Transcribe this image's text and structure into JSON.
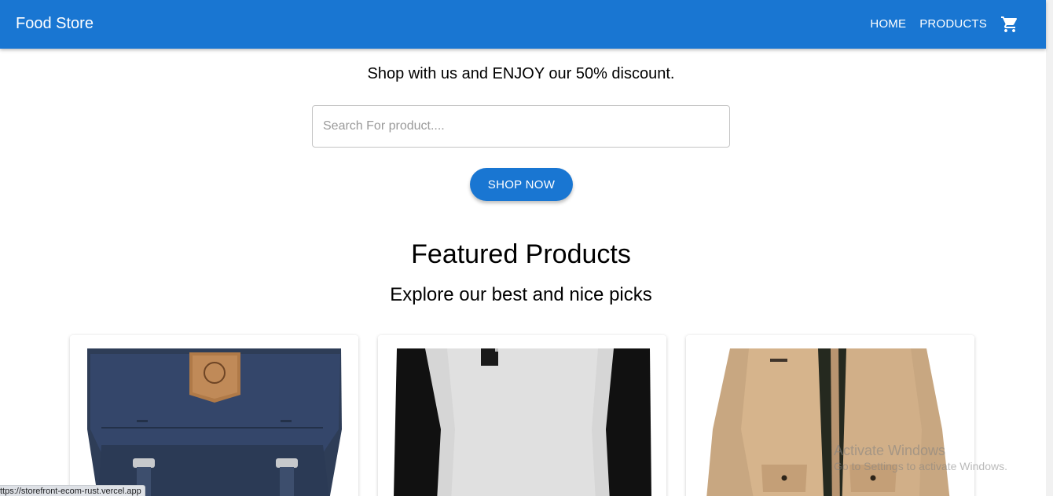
{
  "header": {
    "brand": "Food Store",
    "nav": [
      {
        "label": "HOME"
      },
      {
        "label": "PRODUCTS"
      }
    ],
    "cart_icon": "shopping-cart-icon",
    "color": "#1976d2"
  },
  "hero": {
    "promo": "Shop with us and ENJOY our 50% discount.",
    "search_placeholder": "Search For product....",
    "shop_button": "SHOP NOW"
  },
  "featured": {
    "title": "Featured Products",
    "subtitle": "Explore our best and nice picks",
    "products": [
      {
        "image": "navy-backpack-image"
      },
      {
        "image": "raglan-tshirt-image"
      },
      {
        "image": "khaki-jacket-image"
      }
    ]
  },
  "status_bar": {
    "url": "ttps://storefront-ecom-rust.vercel.app"
  },
  "watermark": {
    "title": "Activate Windows",
    "subtitle": "Go to Settings to activate Windows."
  }
}
